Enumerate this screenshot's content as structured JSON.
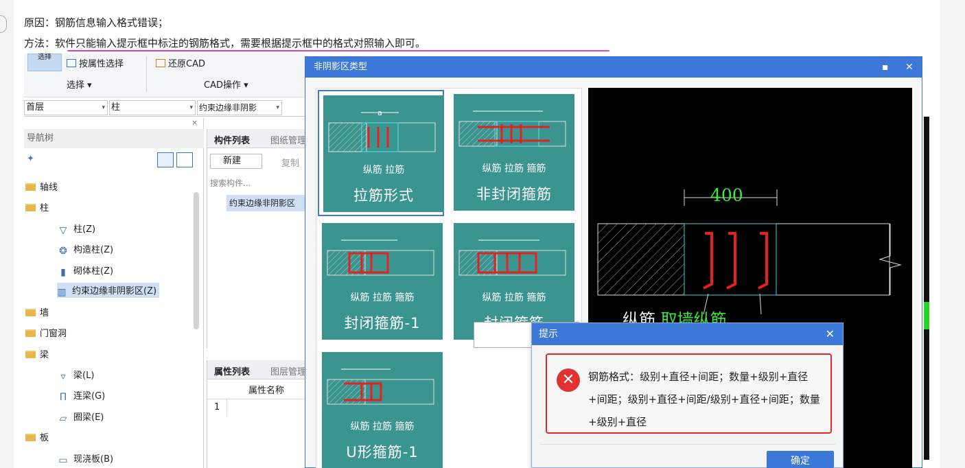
{
  "post": {
    "reason_line": "原因：钢筋信息输入格式错误；",
    "method_label": "方法：",
    "method_text": "软件只能输入提示框中标注的钢筋格式，需要根据提示框中的格式对照输入即可。"
  },
  "ribbon": {
    "select_big": "选择",
    "attr_select": "按属性选择",
    "restore_cad": "还原CAD",
    "select_group": "选择 ▾",
    "cad_group": "CAD操作 ▾"
  },
  "combos": {
    "floor": "首层",
    "type": "柱",
    "component": "约束边缘非阴影"
  },
  "nav": {
    "title": "导航树",
    "items": [
      {
        "label": "轴线",
        "kind": "folder"
      },
      {
        "label": "柱",
        "kind": "folder"
      },
      {
        "label": "柱(Z)",
        "kind": "child"
      },
      {
        "label": "构造柱(Z)",
        "kind": "child"
      },
      {
        "label": "砌体柱(Z)",
        "kind": "child"
      },
      {
        "label": "约束边缘非阴影区(Z)",
        "kind": "child-selected"
      },
      {
        "label": "墙",
        "kind": "folder"
      },
      {
        "label": "门窗洞",
        "kind": "folder"
      },
      {
        "label": "梁",
        "kind": "folder"
      },
      {
        "label": "梁(L)",
        "kind": "child"
      },
      {
        "label": "连梁(G)",
        "kind": "child"
      },
      {
        "label": "圈梁(E)",
        "kind": "child"
      },
      {
        "label": "板",
        "kind": "folder"
      },
      {
        "label": "现浇板(B)",
        "kind": "child"
      }
    ]
  },
  "list_panel": {
    "tab1": "构件列表",
    "tab2": "图纸管理",
    "new_btn": "新建",
    "copy_btn": "复制",
    "search_placeholder": "搜索构件...",
    "item": "约束边缘非阴影区"
  },
  "prop_panel": {
    "tab1": "属性列表",
    "tab2": "图层管理",
    "col_name": "属性名称",
    "row1": "1"
  },
  "dialog": {
    "title": "非阴影区类型",
    "tiles": [
      {
        "label": "拉筋形式",
        "sub": "纵筋  拉筋",
        "top_dim": "a"
      },
      {
        "label": "非封闭箍筋",
        "sub": "纵筋 拉筋 箍筋",
        "top_dim": "a b a"
      },
      {
        "label": "封闭箍筋-1",
        "sub": "纵筋 拉筋  箍筋",
        "top_dim": "a b"
      },
      {
        "label": "封闭箍筋",
        "sub": "纵筋 拉筋 箍筋",
        "top_dim": "a1 b a1"
      },
      {
        "label": "U形箍筋-1",
        "sub": "纵筋 拉筋 箍筋",
        "top_dim": "a b"
      }
    ],
    "preview": {
      "dim": "400",
      "label_white": "纵筋",
      "label_green": "取墙纵筋"
    }
  },
  "hint": {
    "title": "提示",
    "message": "钢筋格式：级别+直径+间距；数量+级别+直径+间距；级别+直径+间距/级别+直径+间距；数量+级别+直径",
    "ok": "确定"
  },
  "colors": {
    "tile": "#3a9490",
    "accent": "#3b78d8",
    "error": "#e02828",
    "cad_green": "#3ce83c",
    "underline": "#e040c8"
  }
}
